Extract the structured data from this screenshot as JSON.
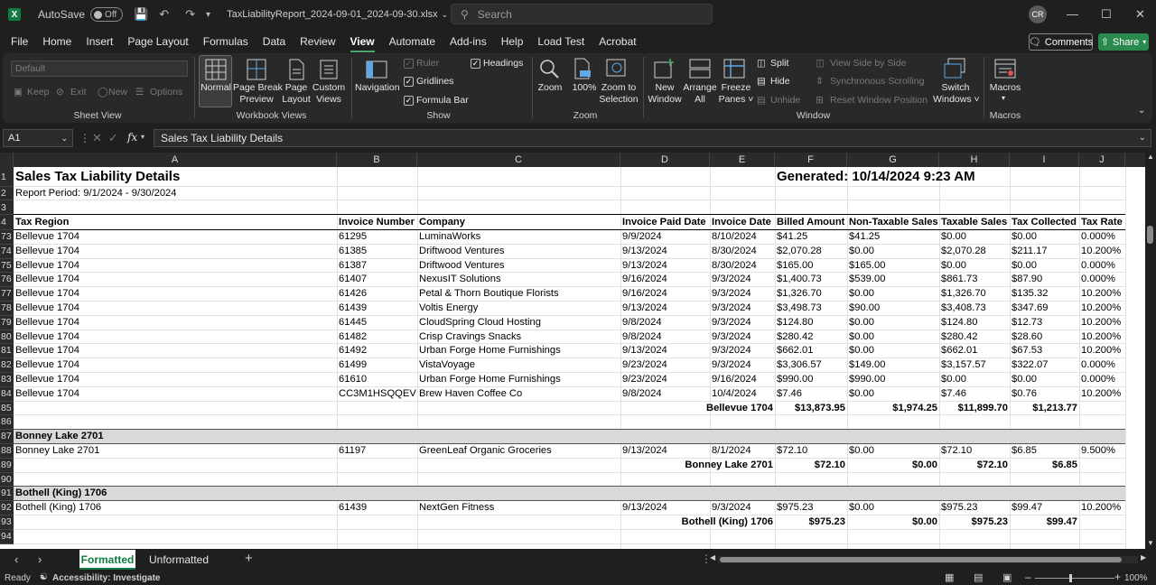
{
  "titlebar": {
    "app_badge": "X",
    "autosave_label": "AutoSave",
    "autosave_state": "Off",
    "filename": "TaxLiabilityReport_2024-09-01_2024-09-30.xlsx",
    "search_placeholder": "Search",
    "user_initials": "CR"
  },
  "menu": {
    "items": [
      "File",
      "Home",
      "Insert",
      "Page Layout",
      "Formulas",
      "Data",
      "Review",
      "View",
      "Automate",
      "Add-ins",
      "Help",
      "Load Test",
      "Acrobat"
    ],
    "active": "View",
    "comments_label": "Comments",
    "share_label": "Share"
  },
  "ribbon": {
    "sheet_view": {
      "dropdown_value": "Default",
      "keep": "Keep",
      "exit": "Exit",
      "new": "New",
      "options": "Options",
      "group_label": "Sheet View"
    },
    "workbook_views": {
      "normal": "Normal",
      "page_break_1": "Page Break",
      "page_break_2": "Preview",
      "page_layout_1": "Page",
      "page_layout_2": "Layout",
      "custom_1": "Custom",
      "custom_2": "Views",
      "group_label": "Workbook Views"
    },
    "show": {
      "navigation": "Navigation",
      "ruler": "Ruler",
      "gridlines": "Gridlines",
      "formula_bar": "Formula Bar",
      "headings": "Headings",
      "group_label": "Show"
    },
    "zoom": {
      "zoom": "Zoom",
      "hundred": "100%",
      "zoom_sel_1": "Zoom to",
      "zoom_sel_2": "Selection",
      "group_label": "Zoom"
    },
    "window": {
      "new_1": "New",
      "new_2": "Window",
      "arrange_1": "Arrange",
      "arrange_2": "All",
      "freeze_1": "Freeze",
      "freeze_2": "Panes ˅",
      "split": "Split",
      "hide": "Hide",
      "unhide": "Unhide",
      "side_by_side": "View Side by Side",
      "sync_scroll": "Synchronous Scrolling",
      "reset_pos": "Reset Window Position",
      "switch_1": "Switch",
      "switch_2": "Windows ˅",
      "group_label": "Window"
    },
    "macros": {
      "macros": "Macros",
      "group_label": "Macros"
    }
  },
  "formula_bar": {
    "name_box": "A1",
    "fx": "fx",
    "content": "Sales Tax Liability Details"
  },
  "columns": [
    "A",
    "B",
    "C",
    "D",
    "E",
    "F",
    "G",
    "H",
    "I",
    "J"
  ],
  "report": {
    "title": "Sales Tax Liability Details",
    "generated": "Generated: 10/14/2024 9:23 AM",
    "period": "Report Period: 9/1/2024 - 9/30/2024",
    "headers": [
      "Tax Region",
      "Invoice Number",
      "Company",
      "Invoice Paid Date",
      "Invoice Date",
      "Billed Amount",
      "Non-Taxable Sales",
      "Taxable Sales",
      "Tax Collected",
      "Tax Rate"
    ]
  },
  "rows": [
    {
      "n": "1"
    },
    {
      "n": "2"
    },
    {
      "n": "3"
    },
    {
      "n": "4"
    },
    {
      "n": "73",
      "cells": [
        "Bellevue 1704",
        "61295",
        "LuminaWorks",
        "9/9/2024",
        "8/10/2024",
        "$41.25",
        "$41.25",
        "$0.00",
        "$0.00",
        "0.000%"
      ]
    },
    {
      "n": "74",
      "cells": [
        "Bellevue 1704",
        "61385",
        "Driftwood Ventures",
        "9/13/2024",
        "8/30/2024",
        "$2,070.28",
        "$0.00",
        "$2,070.28",
        "$211.17",
        "10.200%"
      ]
    },
    {
      "n": "75",
      "cells": [
        "Bellevue 1704",
        "61387",
        "Driftwood Ventures",
        "9/13/2024",
        "8/30/2024",
        "$165.00",
        "$165.00",
        "$0.00",
        "$0.00",
        "0.000%"
      ]
    },
    {
      "n": "76",
      "cells": [
        "Bellevue 1704",
        "61407",
        "NexusIT Solutions",
        "9/16/2024",
        "9/3/2024",
        "$1,400.73",
        "$539.00",
        "$861.73",
        "$87.90",
        "0.000%"
      ]
    },
    {
      "n": "77",
      "cells": [
        "Bellevue 1704",
        "61426",
        "Petal & Thorn Boutique Florists",
        "9/16/2024",
        "9/3/2024",
        "$1,326.70",
        "$0.00",
        "$1,326.70",
        "$135.32",
        "10.200%"
      ]
    },
    {
      "n": "78",
      "cells": [
        "Bellevue 1704",
        "61439",
        "Voltis Energy",
        "9/13/2024",
        "9/3/2024",
        "$3,498.73",
        "$90.00",
        "$3,408.73",
        "$347.69",
        "10.200%"
      ]
    },
    {
      "n": "79",
      "cells": [
        "Bellevue 1704",
        "61445",
        "CloudSpring Cloud Hosting",
        "9/8/2024",
        "9/3/2024",
        "$124.80",
        "$0.00",
        "$124.80",
        "$12.73",
        "10.200%"
      ]
    },
    {
      "n": "80",
      "cells": [
        "Bellevue 1704",
        "61482",
        "Crisp Cravings Snacks",
        "9/8/2024",
        "9/3/2024",
        "$280.42",
        "$0.00",
        "$280.42",
        "$28.60",
        "10.200%"
      ]
    },
    {
      "n": "81",
      "cells": [
        "Bellevue 1704",
        "61492",
        "Urban Forge Home Furnishings",
        "9/13/2024",
        "9/3/2024",
        "$662.01",
        "$0.00",
        "$662.01",
        "$67.53",
        "10.200%"
      ]
    },
    {
      "n": "82",
      "cells": [
        "Bellevue 1704",
        "61499",
        "VistaVoyage",
        "9/23/2024",
        "9/3/2024",
        "$3,306.57",
        "$149.00",
        "$3,157.57",
        "$322.07",
        "0.000%"
      ]
    },
    {
      "n": "83",
      "cells": [
        "Bellevue 1704",
        "61610",
        "Urban Forge Home Furnishings",
        "9/23/2024",
        "9/16/2024",
        "$990.00",
        "$990.00",
        "$0.00",
        "$0.00",
        "0.000%"
      ]
    },
    {
      "n": "84",
      "cells": [
        "Bellevue 1704",
        "CC3M1HSQQEV",
        "Brew Haven Coffee Co",
        "9/8/2024",
        "10/4/2024",
        "$7.46",
        "$0.00",
        "$7.46",
        "$0.76",
        "10.200%"
      ]
    },
    {
      "n": "85",
      "total": [
        "Bellevue 1704",
        "$13,873.95",
        "$1,974.25",
        "$11,899.70",
        "$1,213.77"
      ]
    },
    {
      "n": "86"
    },
    {
      "n": "87",
      "group": "Bonney Lake 2701"
    },
    {
      "n": "88",
      "cells": [
        "Bonney Lake 2701",
        "61197",
        "GreenLeaf Organic Groceries",
        "9/13/2024",
        "8/1/2024",
        "$72.10",
        "$0.00",
        "$72.10",
        "$6.85",
        "9.500%"
      ]
    },
    {
      "n": "89",
      "total": [
        "Bonney Lake 2701",
        "$72.10",
        "$0.00",
        "$72.10",
        "$6.85"
      ]
    },
    {
      "n": "90"
    },
    {
      "n": "91",
      "group": "Bothell (King) 1706"
    },
    {
      "n": "92",
      "cells": [
        "Bothell (King) 1706",
        "61439",
        "NextGen Fitness",
        "9/13/2024",
        "9/3/2024",
        "$975.23",
        "$0.00",
        "$975.23",
        "$99.47",
        "10.200%"
      ]
    },
    {
      "n": "93",
      "total": [
        "Bothell (King) 1706",
        "$975.23",
        "$0.00",
        "$975.23",
        "$99.47"
      ]
    },
    {
      "n": "94"
    }
  ],
  "sheet_tabs": [
    "Formatted",
    "Unformatted"
  ],
  "add_sheet": "+",
  "status": {
    "ready": "Ready",
    "accessibility": "Accessibility: Investigate",
    "zoom": "100%"
  },
  "colors": {
    "excel_green": "#107c41",
    "share_green": "#2a8a4e",
    "band_gray": "#d9d9d9"
  }
}
